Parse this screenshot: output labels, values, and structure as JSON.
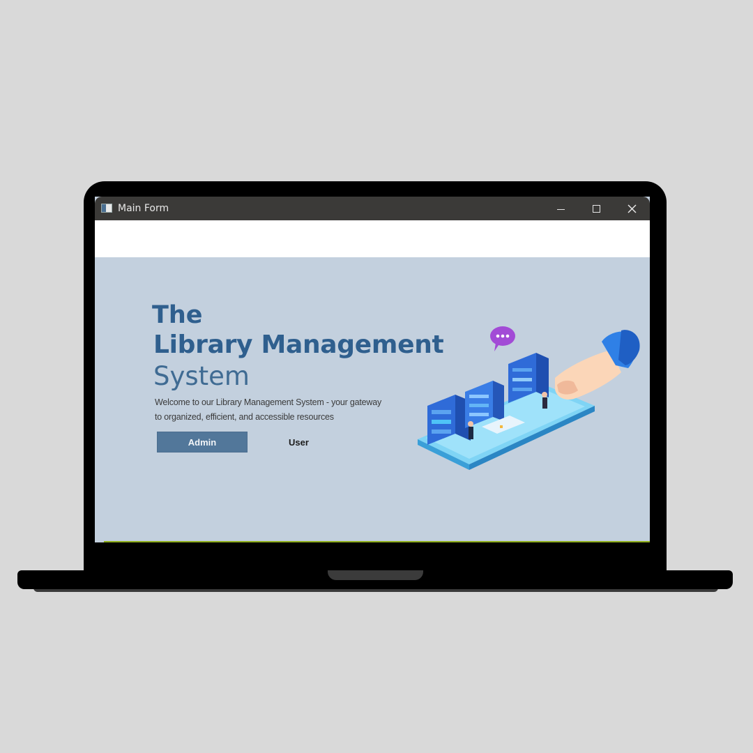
{
  "window": {
    "title": "Main Form"
  },
  "hero": {
    "line1": "The",
    "line2": "Library Management",
    "line3": "System",
    "description_line1": "Welcome to our Library Management System - your gateway",
    "description_line2": "to organized, efficient, and accessible resources"
  },
  "buttons": {
    "admin": "Admin",
    "user": "User"
  },
  "colors": {
    "background": "#d9d9d9",
    "window_body": "#c3d0de",
    "title_text": "#2f5f8e",
    "admin_button": "#52779a",
    "accent_bar": "#8fae1b",
    "titlebar": "#3b3a38"
  },
  "icons": {
    "app": "form-icon",
    "minimize": "minimize-icon",
    "maximize": "maximize-icon",
    "close": "close-icon",
    "illustration": "library-hand-isometric-illustration"
  }
}
